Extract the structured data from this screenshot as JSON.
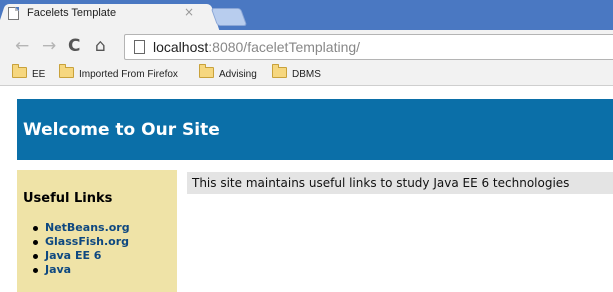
{
  "browser": {
    "tab": {
      "title": "Facelets Template",
      "close_glyph": "×",
      "favicon": "page-icon"
    },
    "toolbar": {
      "back_glyph": "←",
      "forward_glyph": "→",
      "reload_glyph": "C",
      "home_glyph": "⌂",
      "url_host": "localhost",
      "url_rest": ":8080/faceletTemplating/"
    },
    "bookmarks": [
      {
        "label": "EE",
        "icon": "folder-icon"
      },
      {
        "label": "Imported From Firefox",
        "icon": "folder-icon"
      },
      {
        "label": "Advising",
        "icon": "folder-icon"
      },
      {
        "label": "DBMS",
        "icon": "folder-icon"
      }
    ]
  },
  "page": {
    "header_title": "Welcome to Our Site",
    "sidebar": {
      "heading": "Useful Links",
      "links": [
        "NetBeans.org",
        "GlassFish.org",
        "Java EE 6",
        "Java"
      ]
    },
    "content_text": "This site maintains useful links to study Java EE 6 technologies"
  },
  "colors": {
    "tabstrip": "#4a78c2",
    "chrome": "#f2f2f2",
    "header_bg": "#0b6fa8",
    "sidebar_bg": "#efe3a7",
    "content_bg": "#e4e4e4",
    "link": "#0e4880"
  }
}
